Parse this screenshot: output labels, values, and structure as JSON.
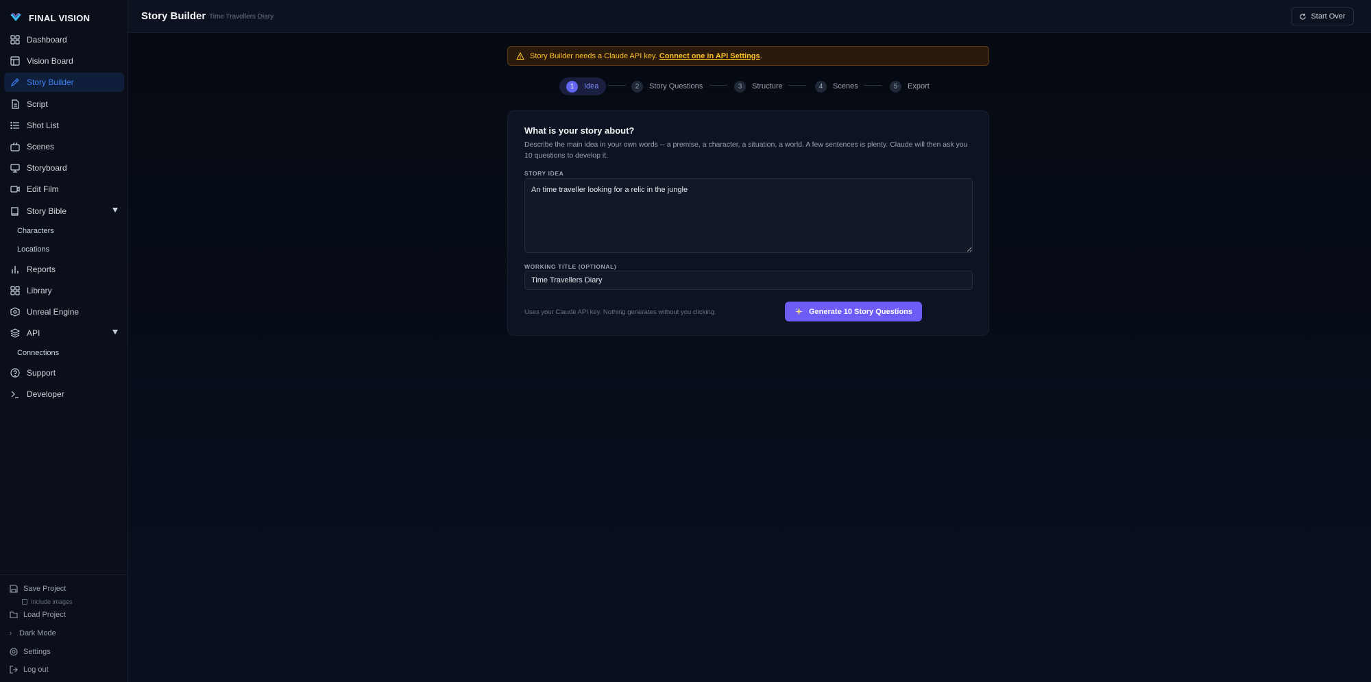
{
  "brand": {
    "name": "FINAL VISION"
  },
  "sidebar": {
    "items": [
      {
        "label": "Dashboard",
        "icon": "grid-icon"
      },
      {
        "label": "Vision Board",
        "icon": "layout-icon"
      },
      {
        "label": "Story Builder",
        "icon": "pen-icon",
        "active": true
      },
      {
        "label": "Script",
        "icon": "file-text-icon"
      },
      {
        "label": "Shot List",
        "icon": "list-icon"
      },
      {
        "label": "Scenes",
        "icon": "clapper-icon"
      },
      {
        "label": "Storyboard",
        "icon": "monitor-icon"
      },
      {
        "label": "Edit Film",
        "icon": "video-icon"
      },
      {
        "label": "Story Bible",
        "icon": "book-icon",
        "expanded": true
      },
      {
        "label": "Reports",
        "icon": "bar-chart-icon"
      },
      {
        "label": "Library",
        "icon": "grid-icon"
      },
      {
        "label": "Unreal Engine",
        "icon": "unreal-icon"
      },
      {
        "label": "API",
        "icon": "layers-icon",
        "expanded": true
      },
      {
        "label": "Support",
        "icon": "help-circle-icon"
      },
      {
        "label": "Developer",
        "icon": "terminal-icon"
      }
    ],
    "story_bible_children": [
      "Characters",
      "Locations"
    ],
    "api_children": [
      "Connections"
    ],
    "bottom": {
      "save_project": "Save Project",
      "include_images": "Include images",
      "load_project": "Load Project",
      "dark_mode": "Dark Mode",
      "settings": "Settings",
      "log_out": "Log out"
    }
  },
  "header": {
    "title": "Story Builder",
    "subtitle": "Time Travellers Diary",
    "start_over": "Start Over"
  },
  "warning": {
    "text": "Story Builder needs a Claude API key.",
    "link": "Connect one in API Settings",
    "suffix": "."
  },
  "steps": [
    {
      "num": "1",
      "label": "Idea",
      "active": true
    },
    {
      "num": "2",
      "label": "Story Questions"
    },
    {
      "num": "3",
      "label": "Structure"
    },
    {
      "num": "4",
      "label": "Scenes"
    },
    {
      "num": "5",
      "label": "Export"
    }
  ],
  "card": {
    "title": "What is your story about?",
    "description": "Describe the main idea in your own words -- a premise, a character, a situation, a world. A few sentences is plenty. Claude will then ask you 10 questions to develop it.",
    "story_idea_label": "STORY IDEA",
    "story_idea_value": "An time traveller looking for a relic in the jungle",
    "working_title_label": "WORKING TITLE (OPTIONAL)",
    "working_title_value": "Time Travellers Diary",
    "hint": "Uses your Claude API key. Nothing generates without you clicking.",
    "generate_button": "Generate 10 Story Questions"
  },
  "colors": {
    "accent": "#6d5cf5",
    "active_nav": "#3b82f6",
    "warning": "#fbbf24",
    "background": "#070b14"
  }
}
